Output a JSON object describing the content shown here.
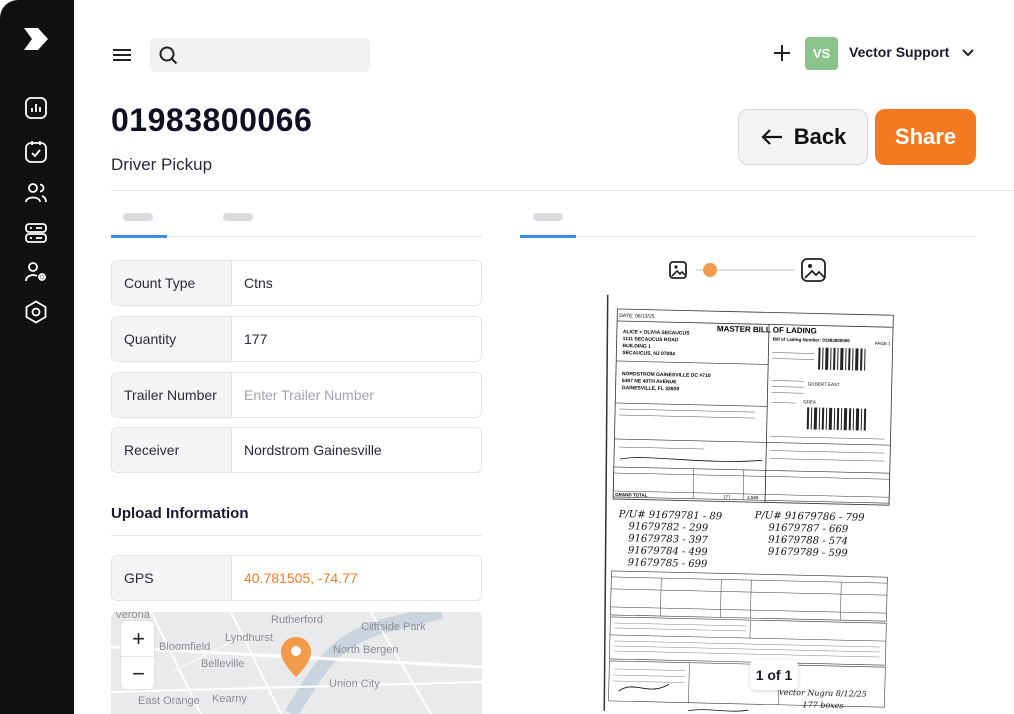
{
  "header": {
    "title": "01983800066",
    "subtitle": "Driver Pickup",
    "back_label": "Back",
    "share_label": "Share"
  },
  "user": {
    "initials": "VS",
    "name": "Vector Support"
  },
  "search": {
    "placeholder": ""
  },
  "form": {
    "rows": [
      {
        "label": "Count Type",
        "value": "Ctns"
      },
      {
        "label": "Quantity",
        "value": "177"
      },
      {
        "label": "Trailer Number",
        "placeholder": "Enter Trailer Number"
      },
      {
        "label": "Receiver",
        "value": "Nordstrom Gainesville"
      }
    ]
  },
  "upload": {
    "title": "Upload Information",
    "gps_label": "GPS",
    "gps_value": "40.781505, -74.77"
  },
  "map": {
    "places": [
      "Verona",
      "Rutherford",
      "Lyndhurst",
      "Bloomfield",
      "Belleville",
      "Cliffside Park",
      "North Bergen",
      "Union City",
      "East Orange",
      "Kearny"
    ],
    "zoom_in": "+",
    "zoom_out": "−"
  },
  "viewer": {
    "pager": "1 of 1"
  },
  "document": {
    "title": "MASTER BILL OF LADING",
    "date": "DATE: 06/13/25",
    "page": "PAGE:1",
    "ship_from_name": "ALICE + OLIVIA SECAUCUS",
    "ship_from_addr1": "1111 SECAUCUS ROAD",
    "ship_from_addr2": "BUILDING 1",
    "ship_from_addr3": "SECAUCUS, NJ 07094",
    "ship_to_name": "NORDSTROM GAINESVILLE DC #710",
    "ship_to_addr1": "5497 NE 40TH AVENUE",
    "ship_to_addr2": "GAINESVILLE, FL 32609",
    "bol_number": "Bill of Lading Number: 01983800066",
    "carrier": "GILBERT EAST",
    "scac": "GDEA",
    "grand_total_label": "GRAND TOTAL",
    "total_packages": "177",
    "total_weight": "4,566",
    "handwriting": [
      "P/U# 91679781 - 89",
      "91679782 - 299",
      "91679783 - 397",
      "91679784 - 499",
      "91679785 - 699",
      "P/U# 91679786 - 799",
      "91679787 - 669",
      "91679788 - 574",
      "91679789 - 599"
    ],
    "footer_note": "177 boxes",
    "carrier_sig": "Vector Nugra 8/12/25"
  },
  "colors": {
    "accent": "#f47920",
    "tab_active": "#3a8ee6",
    "avatar": "#8bc48a",
    "sidebar": "#111114"
  },
  "icons": {
    "sidebar": [
      "logo-icon",
      "analytics-icon",
      "tasks-icon",
      "users-icon",
      "servers-icon",
      "user-settings-icon",
      "hexagon-settings-icon"
    ],
    "topbar": [
      "menu-icon",
      "search-icon",
      "plus-icon",
      "chevron-down-icon"
    ],
    "viewer": [
      "image-small-icon",
      "image-large-icon"
    ]
  }
}
